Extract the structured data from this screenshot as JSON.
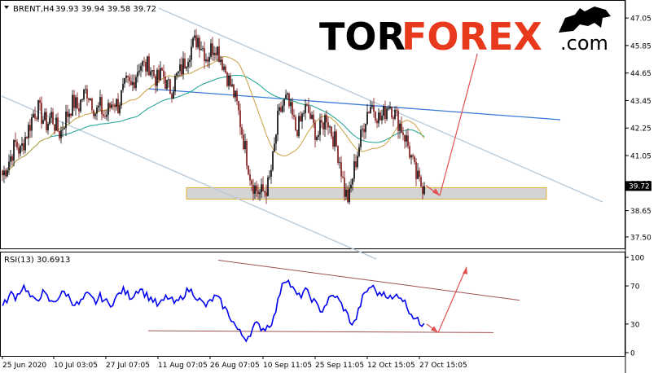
{
  "chart_data": [
    {
      "type": "candlestick",
      "title": "BRENT,H4",
      "ohlc_label": "39.93 39.94 39.58 39.72",
      "current_price": "39.72",
      "ylim": [
        37.0,
        47.8
      ],
      "y_ticks": [
        "47.05",
        "45.85",
        "44.65",
        "43.45",
        "42.25",
        "41.05",
        "39.85",
        "38.65",
        "37.50"
      ],
      "x_ticks": [
        "25 Jun 2020",
        "10 Jul 03:05",
        "27 Jul 07:05",
        "11 Aug 07:05",
        "26 Aug 07:05",
        "10 Sep 11:05",
        "25 Sep 11:05",
        "12 Oct 15:05",
        "27 Oct 15:05"
      ],
      "close_path": [
        40.2,
        40.6,
        41.1,
        41.6,
        41.2,
        41.8,
        42.3,
        42.9,
        43.1,
        42.7,
        42.4,
        42.8,
        42.3,
        42.0,
        42.6,
        43.0,
        43.4,
        43.1,
        43.6,
        43.9,
        43.5,
        42.9,
        43.2,
        42.7,
        43.1,
        43.5,
        43.2,
        43.8,
        44.2,
        44.0,
        44.6,
        45.1,
        44.9,
        45.0,
        44.6,
        44.3,
        44.7,
        44.1,
        43.9,
        44.4,
        44.7,
        45.1,
        45.6,
        45.9,
        46.2,
        45.8,
        45.3,
        45.7,
        45.9,
        45.4,
        44.9,
        44.3,
        43.8,
        43.1,
        42.0,
        41.0,
        40.0,
        39.6,
        39.4,
        39.5,
        39.8,
        41.0,
        42.6,
        43.2,
        43.5,
        42.9,
        42.2,
        42.4,
        43.1,
        42.9,
        42.3,
        41.9,
        42.4,
        42.8,
        42.1,
        41.6,
        40.8,
        39.5,
        39.1,
        40.3,
        41.2,
        42.1,
        42.9,
        43.3,
        43.0,
        42.6,
        42.9,
        43.4,
        43.0,
        42.6,
        42.2,
        41.7,
        41.0,
        40.2,
        39.8,
        39.72
      ],
      "sma_fast_start": 3,
      "sma_slow_start": 0,
      "sma_fast_window": 10,
      "sma_slow_window": 28,
      "support_zone": [
        39.15,
        39.65
      ],
      "projection_target": 46.0
    },
    {
      "type": "line",
      "title": "RSI(13) 30.6913",
      "ylim": [
        0,
        100
      ],
      "y_ticks": [
        "100",
        "70",
        "30",
        "0"
      ],
      "values": [
        48,
        56,
        62,
        58,
        66,
        70,
        60,
        54,
        57,
        63,
        58,
        52,
        56,
        60,
        64,
        58,
        52,
        50,
        55,
        61,
        57,
        53,
        59,
        55,
        50,
        54,
        60,
        66,
        62,
        58,
        64,
        68,
        62,
        58,
        55,
        49,
        53,
        59,
        55,
        51,
        56,
        62,
        66,
        63,
        57,
        52,
        49,
        55,
        59,
        54,
        47,
        40,
        32,
        24,
        18,
        15,
        22,
        30,
        27,
        25,
        29,
        34,
        52,
        74,
        78,
        70,
        62,
        58,
        66,
        61,
        55,
        48,
        44,
        52,
        58,
        60,
        53,
        46,
        37,
        28,
        40,
        56,
        64,
        70,
        66,
        60,
        64,
        59,
        55,
        62,
        58,
        50,
        42,
        36,
        31,
        30.69
      ]
    }
  ],
  "brand": {
    "name": "TORFOREX",
    "domain": ".com"
  },
  "colors": {
    "bull_candle": "#7a1010",
    "bear_candle": "#000000",
    "rsi_line": "#0000ee",
    "price_tag": "#000000"
  }
}
